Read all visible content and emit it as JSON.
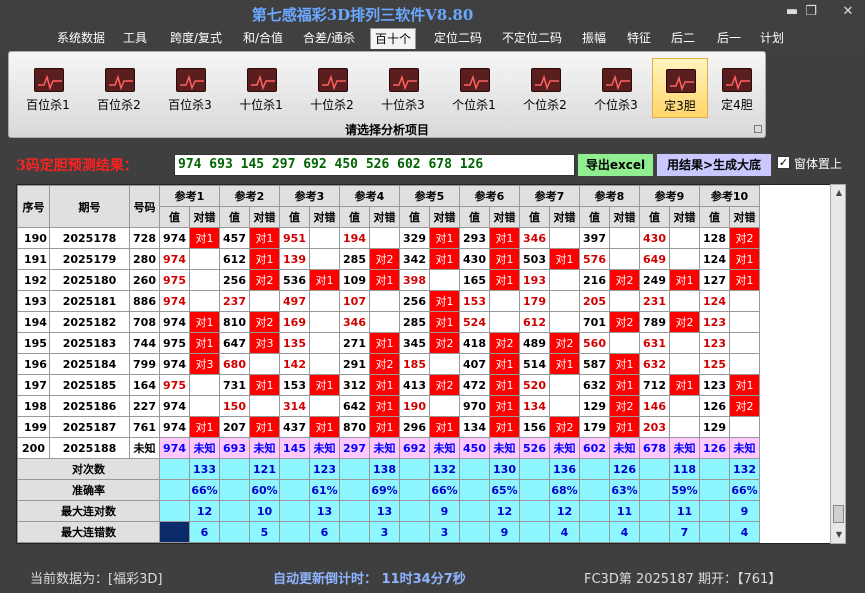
{
  "window": {
    "title": "第七感福彩3D排列三软件V8.80",
    "min": "▬",
    "max": "❐",
    "close": "✕"
  },
  "menu": [
    "系统数据",
    "工具",
    "跨度/复式",
    "和/合值",
    "合差/通杀",
    "百十个",
    "定位二码",
    "不定位二码",
    "振幅",
    "特征",
    "后二",
    "后一",
    "计划"
  ],
  "menu_active": 5,
  "ribbon": {
    "buttons": [
      "百位杀1",
      "百位杀2",
      "百位杀3",
      "十位杀1",
      "十位杀2",
      "十位杀3",
      "个位杀1",
      "个位杀2",
      "个位杀3",
      "定3胆",
      "定4胆"
    ],
    "active": 9,
    "caption": "请选择分析项目"
  },
  "result": {
    "label": "3码定胆预测结果：",
    "value": "974 693 145 297 692 450 526 602 678 126",
    "excel_button": "导出excel",
    "gen_button": "用结果>生成大底",
    "topmost_label": "窗体置上",
    "topmost_checked": "✓"
  },
  "table": {
    "head_seq": "序号",
    "head_issue": "期号",
    "head_num": "号码",
    "ref_headers": [
      "参考1",
      "参考2",
      "参考3",
      "参考4",
      "参考5",
      "参考6",
      "参考7",
      "参考8",
      "参考9",
      "参考10"
    ],
    "sub_value": "值",
    "sub_check": "对错",
    "rows": [
      {
        "seq": "190",
        "issue": "2025178",
        "num": "728",
        "v": [
          "974",
          "457",
          "951",
          "194",
          "329",
          "293",
          "346",
          "397",
          "430",
          "128"
        ],
        "r": [
          "对1",
          "对1",
          "",
          "",
          "对1",
          "对1",
          "",
          "",
          "",
          "对2"
        ],
        "red": [
          0,
          0,
          1,
          1,
          0,
          0,
          1,
          0,
          1,
          0
        ]
      },
      {
        "seq": "191",
        "issue": "2025179",
        "num": "280",
        "v": [
          "974",
          "612",
          "139",
          "285",
          "342",
          "430",
          "503",
          "576",
          "649",
          "124"
        ],
        "r": [
          "",
          "对1",
          "",
          "对2",
          "对1",
          "对1",
          "对1",
          "",
          "",
          "对1"
        ],
        "red": [
          1,
          0,
          1,
          0,
          0,
          0,
          0,
          1,
          1,
          0
        ]
      },
      {
        "seq": "192",
        "issue": "2025180",
        "num": "260",
        "v": [
          "975",
          "256",
          "536",
          "109",
          "398",
          "165",
          "193",
          "216",
          "249",
          "127"
        ],
        "r": [
          "",
          "对2",
          "对1",
          "对1",
          "",
          "对1",
          "",
          "对2",
          "对1",
          "对1"
        ],
        "red": [
          1,
          0,
          0,
          0,
          1,
          0,
          1,
          0,
          0,
          0
        ]
      },
      {
        "seq": "193",
        "issue": "2025181",
        "num": "886",
        "v": [
          "974",
          "237",
          "497",
          "107",
          "256",
          "153",
          "179",
          "205",
          "231",
          "124"
        ],
        "r": [
          "",
          "",
          "",
          "",
          "对1",
          "",
          "",
          "",
          "",
          ""
        ],
        "red": [
          1,
          1,
          1,
          1,
          0,
          1,
          1,
          1,
          1,
          1
        ]
      },
      {
        "seq": "194",
        "issue": "2025182",
        "num": "708",
        "v": [
          "974",
          "810",
          "169",
          "346",
          "285",
          "524",
          "612",
          "701",
          "789",
          "123"
        ],
        "r": [
          "对1",
          "对2",
          "",
          "",
          "对1",
          "",
          "",
          "对2",
          "对2",
          ""
        ],
        "red": [
          0,
          0,
          1,
          1,
          0,
          1,
          1,
          0,
          0,
          1
        ]
      },
      {
        "seq": "195",
        "issue": "2025183",
        "num": "744",
        "v": [
          "975",
          "647",
          "135",
          "271",
          "345",
          "418",
          "489",
          "560",
          "631",
          "123"
        ],
        "r": [
          "对1",
          "对3",
          "",
          "对1",
          "对2",
          "对2",
          "对2",
          "",
          "",
          ""
        ],
        "red": [
          0,
          0,
          1,
          0,
          0,
          0,
          0,
          1,
          1,
          1
        ]
      },
      {
        "seq": "196",
        "issue": "2025184",
        "num": "799",
        "v": [
          "974",
          "680",
          "142",
          "291",
          "185",
          "407",
          "514",
          "587",
          "632",
          "125"
        ],
        "r": [
          "对3",
          "",
          "",
          "对2",
          "",
          "对1",
          "对1",
          "对1",
          "",
          ""
        ],
        "red": [
          0,
          1,
          1,
          0,
          1,
          0,
          0,
          0,
          1,
          1
        ]
      },
      {
        "seq": "197",
        "issue": "2025185",
        "num": "164",
        "v": [
          "975",
          "731",
          "153",
          "312",
          "413",
          "472",
          "520",
          "632",
          "712",
          "123"
        ],
        "r": [
          "",
          "对1",
          "对1",
          "对1",
          "对2",
          "对1",
          "",
          "对1",
          "对1",
          "对1"
        ],
        "red": [
          1,
          0,
          0,
          0,
          0,
          0,
          1,
          0,
          0,
          0
        ]
      },
      {
        "seq": "198",
        "issue": "2025186",
        "num": "227",
        "v": [
          "974",
          "150",
          "314",
          "642",
          "190",
          "970",
          "134",
          "129",
          "146",
          "126"
        ],
        "r": [
          "",
          "",
          "",
          "对1",
          "",
          "对1",
          "",
          "对2",
          "",
          "对2"
        ],
        "red": [
          0,
          1,
          1,
          0,
          1,
          0,
          1,
          0,
          1,
          0
        ]
      },
      {
        "seq": "199",
        "issue": "2025187",
        "num": "761",
        "v": [
          "974",
          "207",
          "437",
          "870",
          "296",
          "134",
          "156",
          "179",
          "203",
          "129"
        ],
        "r": [
          "对1",
          "对1",
          "对1",
          "对1",
          "对1",
          "对1",
          "对2",
          "对1",
          "",
          ""
        ],
        "red": [
          0,
          0,
          0,
          0,
          0,
          0,
          0,
          0,
          1,
          0
        ]
      }
    ],
    "pred": {
      "seq": "200",
      "issue": "2025188",
      "num": "未知",
      "v": [
        "974",
        "693",
        "145",
        "297",
        "692",
        "450",
        "526",
        "602",
        "678",
        "126"
      ],
      "r": "未知"
    },
    "stats": [
      {
        "label": "对次数",
        "v": [
          "133",
          "121",
          "123",
          "138",
          "132",
          "130",
          "136",
          "126",
          "118",
          "132"
        ]
      },
      {
        "label": "准确率",
        "v": [
          "66%",
          "60%",
          "61%",
          "69%",
          "66%",
          "65%",
          "68%",
          "63%",
          "59%",
          "66%"
        ]
      },
      {
        "label": "最大连对数",
        "v": [
          "12",
          "10",
          "13",
          "13",
          "9",
          "12",
          "12",
          "11",
          "11",
          "9"
        ]
      },
      {
        "label": "最大连错数",
        "v": [
          "6",
          "5",
          "6",
          "3",
          "3",
          "9",
          "4",
          "4",
          "7",
          "4"
        ]
      }
    ]
  },
  "status": {
    "data": "当前数据为：[福彩3D]",
    "countdown": "自动更新倒计时： 11时34分7秒",
    "issue": "FC3D第 2025187 期开：【761】"
  }
}
